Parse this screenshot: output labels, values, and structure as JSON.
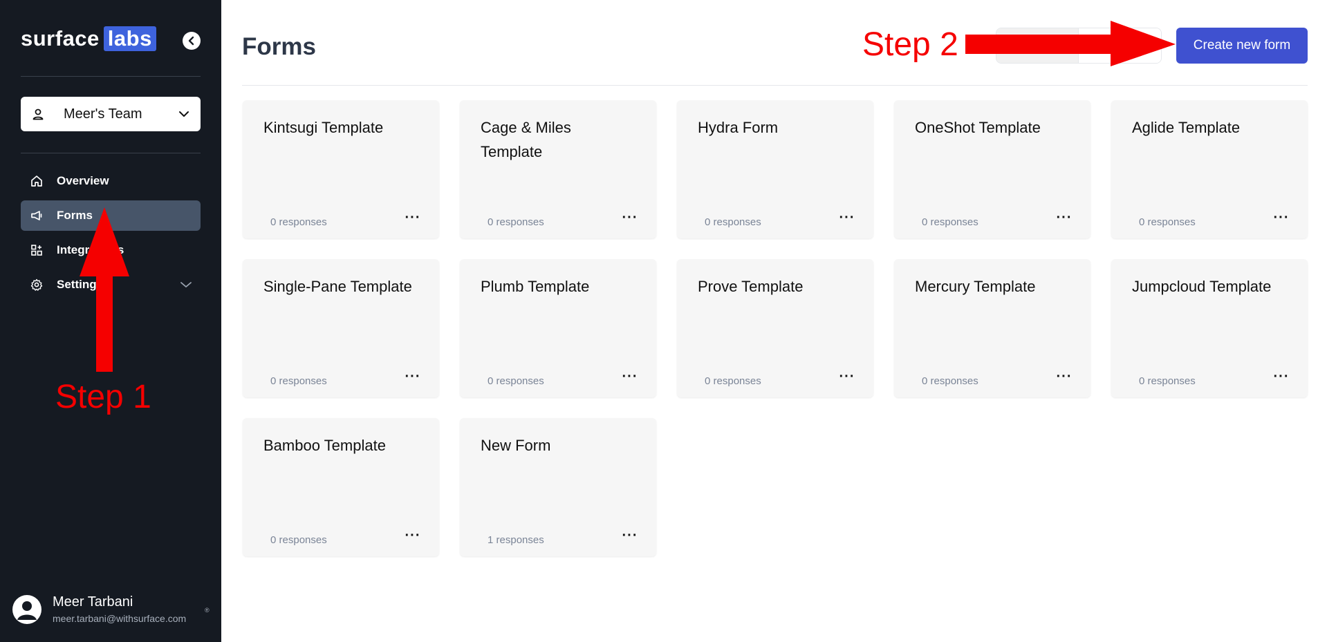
{
  "brand": {
    "name_part1": "surface",
    "name_part2": "labs"
  },
  "team_selector": {
    "label": "Meer's Team"
  },
  "sidebar": {
    "items": [
      {
        "label": "Overview",
        "icon": "home-icon"
      },
      {
        "label": "Forms",
        "icon": "megaphone-icon",
        "active": true
      },
      {
        "label": "Integrations",
        "icon": "grid-plus-icon"
      },
      {
        "label": "Settings",
        "icon": "gear-icon"
      }
    ]
  },
  "user": {
    "name": "Meer Tarbani",
    "email": "meer.tarbani@withsurface.com",
    "mark": "®"
  },
  "page": {
    "title": "Forms",
    "create_button": "Create new form"
  },
  "forms": [
    {
      "title": "Kintsugi Template",
      "responses": "0 responses"
    },
    {
      "title": "Cage & Miles Template",
      "responses": "0 responses"
    },
    {
      "title": "Hydra Form",
      "responses": "0 responses"
    },
    {
      "title": "OneShot Template",
      "responses": "0 responses"
    },
    {
      "title": "Aglide Template",
      "responses": "0 responses"
    },
    {
      "title": "Single-Pane Template",
      "responses": "0 responses"
    },
    {
      "title": "Plumb Template",
      "responses": "0 responses"
    },
    {
      "title": "Prove Template",
      "responses": "0 responses"
    },
    {
      "title": "Mercury Template",
      "responses": "0 responses"
    },
    {
      "title": "Jumpcloud Template",
      "responses": "0 responses"
    },
    {
      "title": "Bamboo Template",
      "responses": "0 responses"
    },
    {
      "title": "New Form",
      "responses": "1 responses"
    }
  ],
  "annotations": {
    "step1": "Step 1",
    "step2": "Step 2"
  },
  "colors": {
    "sidebar_bg": "#151a22",
    "accent": "#3f51d0",
    "annotation": "#f50000"
  }
}
